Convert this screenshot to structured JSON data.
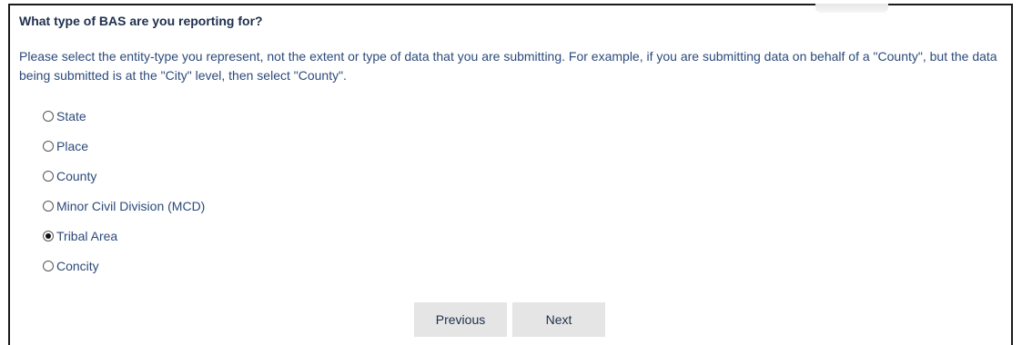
{
  "question": {
    "title": "What type of BAS are you reporting for?",
    "instructions": "Please select the entity-type you represent, not the extent or type of data that you are submitting. For example, if you are submitting data on behalf of a \"County\", but the data being submitted is at the \"City\" level, then select \"County\"."
  },
  "options": [
    {
      "label": "State",
      "selected": false
    },
    {
      "label": "Place",
      "selected": false
    },
    {
      "label": "County",
      "selected": false
    },
    {
      "label": "Minor Civil Division (MCD)",
      "selected": false
    },
    {
      "label": "Tribal Area",
      "selected": true
    },
    {
      "label": "Concity",
      "selected": false
    }
  ],
  "buttons": {
    "previous": "Previous",
    "next": "Next"
  },
  "colors": {
    "title": "#1e2f4d",
    "text": "#2c4a7a",
    "button_bg": "#e5e5e5",
    "border": "#1a1a1a"
  }
}
